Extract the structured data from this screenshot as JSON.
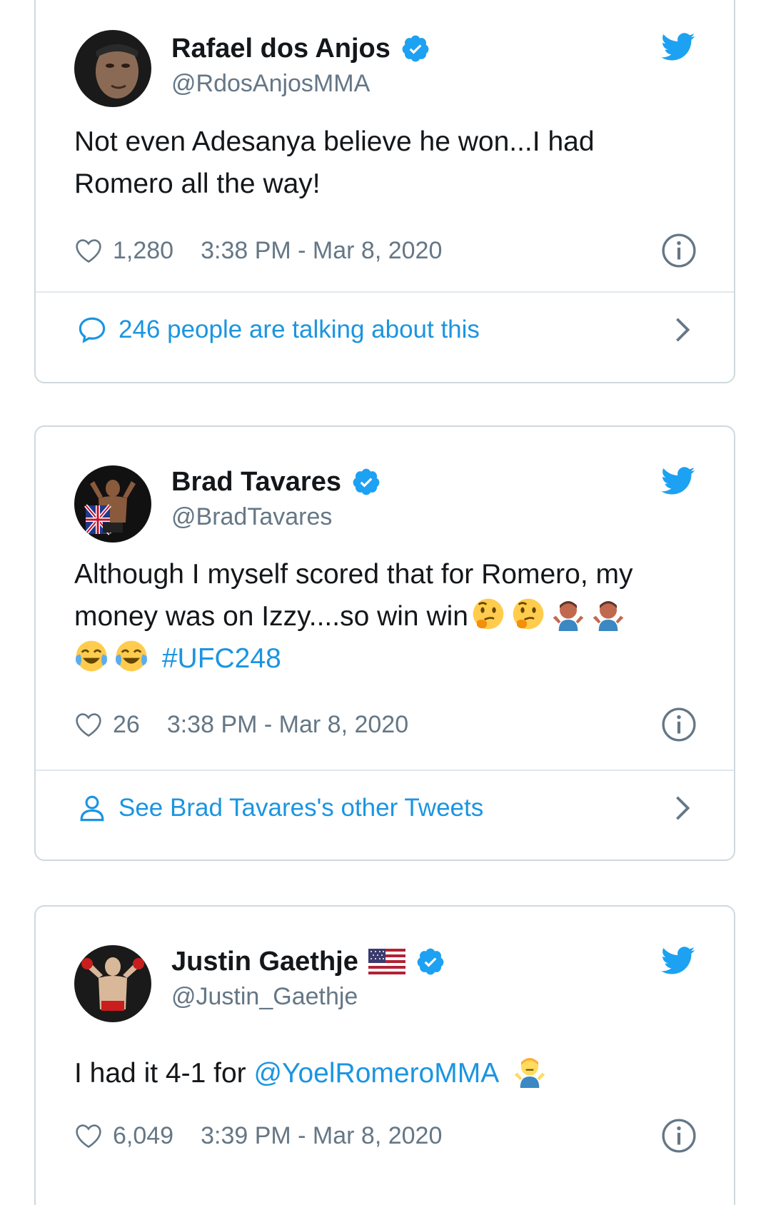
{
  "tweets": [
    {
      "name": "Rafael dos Anjos",
      "handle": "@RdosAnjosMMA",
      "text_line1": "Not even Adesanya believe he won...I had",
      "text_line2": "Romero all the way!",
      "likes": "1,280",
      "timestamp": "3:38 PM - Mar 8, 2020",
      "footer": "246 people are talking about this",
      "footer_icon": "speech-bubble-icon",
      "avatar_colors": [
        "#2a2a2a",
        "#8b6a55"
      ]
    },
    {
      "name": "Brad Tavares",
      "handle": "@BradTavares",
      "text_line1": "Although I myself scored that for Romero, my",
      "text_line2": "money was on Izzy....so win win",
      "hashtag": "#UFC248",
      "likes": "26",
      "timestamp": "3:38 PM - Mar 8, 2020",
      "footer": "See Brad Tavares's other Tweets",
      "footer_icon": "person-icon",
      "emojis": [
        "thinking-face",
        "thinking-face",
        "person-shrugging",
        "person-shrugging",
        "face-with-tears-of-joy",
        "face-with-tears-of-joy"
      ]
    },
    {
      "name": "Justin Gaethje",
      "handle": "@Justin_Gaethje",
      "text_prefix": "I had it 4-1 for ",
      "mention": "@YoelRomeroMMA",
      "likes": "6,049",
      "timestamp": "3:39 PM - Mar 8, 2020",
      "emojis": [
        "person-shrugging"
      ],
      "name_flag": "us-flag"
    }
  ],
  "colors": {
    "link": "#1b95e0",
    "secondary_text": "#657786",
    "border": "#cfd9de",
    "verified": "#1da1f2",
    "twitter_blue": "#1da1f2"
  }
}
